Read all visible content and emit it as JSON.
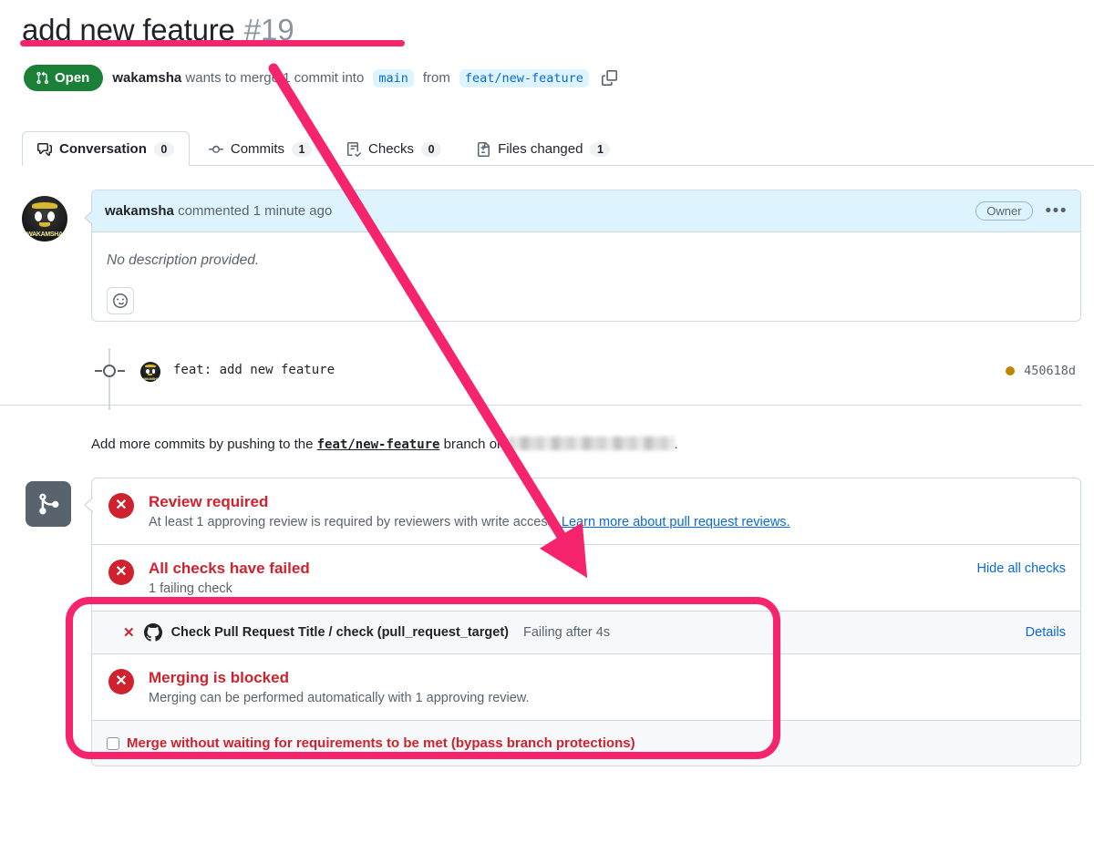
{
  "header": {
    "title": "add new feature",
    "number": "#19",
    "state_label": "Open",
    "state_color": "#1a7f37",
    "author": "wakamsha",
    "meta_before": "wants to merge 1 commit into",
    "base_branch": "main",
    "meta_from": "from",
    "head_branch": "feat/new-feature",
    "copy_icon": "copy-icon"
  },
  "tabs": [
    {
      "label": "Conversation",
      "count": "0",
      "icon": "comment-discussion-icon",
      "active": true
    },
    {
      "label": "Commits",
      "count": "1",
      "icon": "git-commit-icon",
      "active": false
    },
    {
      "label": "Checks",
      "count": "0",
      "icon": "checklist-icon",
      "active": false
    },
    {
      "label": "Files changed",
      "count": "1",
      "icon": "file-diff-icon",
      "active": false
    }
  ],
  "comment": {
    "author": "wakamsha",
    "action": "commented",
    "time": "1 minute ago",
    "badge": "Owner",
    "menu_icon": "kebab-horizontal-icon",
    "body": "No description provided.",
    "reaction_icon": "smiley-icon",
    "avatar_name": "WAKAMSHA"
  },
  "timeline": {
    "commit_message": "feat: add new feature",
    "commit_sha": "450618d",
    "status_dot_color": "#bf8700",
    "avatar_name": "WAKAMSHA"
  },
  "push_hint": {
    "prefix": "Add more commits by pushing to the",
    "branch": "feat/new-feature",
    "middle": "branch on",
    "repo_redacted": true,
    "suffix": "."
  },
  "merge_box": {
    "icon": "git-merge-icon",
    "sections": [
      {
        "heading": "Review required",
        "description": "At least 1 approving review is required by reviewers with write access.",
        "link_text": "Learn more about pull request reviews.",
        "status_icon": "x-circle-icon"
      },
      {
        "heading": "All checks have failed",
        "description": "1 failing check",
        "action_link": "Hide all checks",
        "status_icon": "x-circle-icon"
      },
      {
        "heading": "Merging is blocked",
        "description": "Merging can be performed automatically with 1 approving review.",
        "status_icon": "x-circle-icon"
      }
    ],
    "check_row": {
      "status_icon": "x-icon",
      "provider_icon": "github-mark-icon",
      "name": "Check Pull Request Title / check (pull_request_target)",
      "duration": "Failing after 4s",
      "details_link": "Details"
    },
    "bypass": {
      "checked": false,
      "label": "Merge without waiting for requirements to be met (bypass branch protections)"
    }
  },
  "annotations": {
    "accent_color": "#f6246c",
    "title_underline": true,
    "arrow_from_title_to_checks": true,
    "highlight_box_around_checks": true
  }
}
